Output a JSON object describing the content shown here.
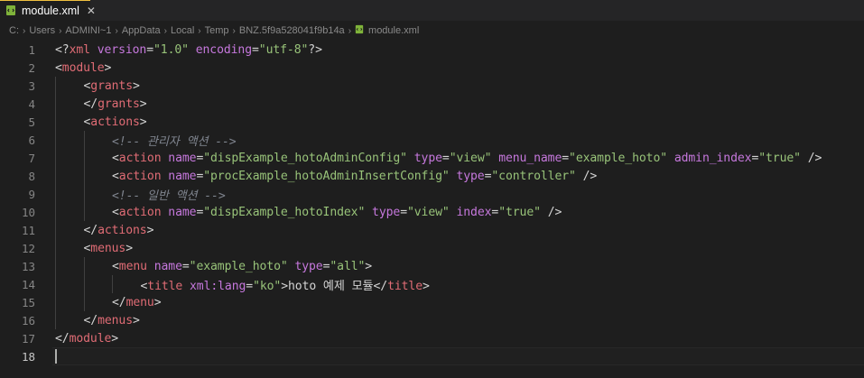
{
  "tab": {
    "name": "module.xml",
    "close": "✕"
  },
  "breadcrumb": {
    "parts": [
      "C:",
      "Users",
      "ADMINI~1",
      "AppData",
      "Local",
      "Temp",
      "BNZ.5f9a528041f9b14a"
    ],
    "file": "module.xml",
    "separator": "›"
  },
  "colors": {
    "tag": "#e06c75",
    "attribute": "#c678dd",
    "string": "#98c379",
    "comment": "#7f848e",
    "bracket": "#56b6c2",
    "file_icon": "#7fb33a"
  },
  "editor": {
    "current_line": 18,
    "lines": [
      {
        "n": "1",
        "indent": 0,
        "tokens": [
          [
            "punct",
            "<?"
          ],
          [
            "tag",
            "xml"
          ],
          [
            "text",
            " "
          ],
          [
            "attr",
            "version"
          ],
          [
            "eq",
            "="
          ],
          [
            "str",
            "\"1.0\""
          ],
          [
            "text",
            " "
          ],
          [
            "attr",
            "encoding"
          ],
          [
            "eq",
            "="
          ],
          [
            "str",
            "\"utf-8\""
          ],
          [
            "punct",
            "?>"
          ]
        ]
      },
      {
        "n": "2",
        "indent": 0,
        "tokens": [
          [
            "punct",
            "<"
          ],
          [
            "tag",
            "module"
          ],
          [
            "punct",
            ">"
          ]
        ]
      },
      {
        "n": "3",
        "indent": 1,
        "tokens": [
          [
            "punct",
            "<"
          ],
          [
            "tag",
            "grants"
          ],
          [
            "punct",
            ">"
          ]
        ]
      },
      {
        "n": "4",
        "indent": 1,
        "tokens": [
          [
            "punct",
            "</"
          ],
          [
            "tag",
            "grants"
          ],
          [
            "punct",
            ">"
          ]
        ]
      },
      {
        "n": "5",
        "indent": 1,
        "tokens": [
          [
            "punct",
            "<"
          ],
          [
            "tag",
            "actions"
          ],
          [
            "punct",
            ">"
          ]
        ]
      },
      {
        "n": "6",
        "indent": 2,
        "tokens": [
          [
            "comment",
            "<!-- 관리자 액션 -->"
          ]
        ]
      },
      {
        "n": "7",
        "indent": 2,
        "tokens": [
          [
            "punct",
            "<"
          ],
          [
            "tag",
            "action"
          ],
          [
            "text",
            " "
          ],
          [
            "attr",
            "name"
          ],
          [
            "eq",
            "="
          ],
          [
            "str",
            "\"dispExample_hotoAdminConfig\""
          ],
          [
            "text",
            " "
          ],
          [
            "attr",
            "type"
          ],
          [
            "eq",
            "="
          ],
          [
            "str",
            "\"view\""
          ],
          [
            "text",
            " "
          ],
          [
            "attr",
            "menu_name"
          ],
          [
            "eq",
            "="
          ],
          [
            "str",
            "\"example_hoto\""
          ],
          [
            "text",
            " "
          ],
          [
            "attr",
            "admin_index"
          ],
          [
            "eq",
            "="
          ],
          [
            "str",
            "\"true\""
          ],
          [
            "text",
            " "
          ],
          [
            "punct",
            "/>"
          ]
        ]
      },
      {
        "n": "8",
        "indent": 2,
        "tokens": [
          [
            "punct",
            "<"
          ],
          [
            "tag",
            "action"
          ],
          [
            "text",
            " "
          ],
          [
            "attr",
            "name"
          ],
          [
            "eq",
            "="
          ],
          [
            "str",
            "\"procExample_hotoAdminInsertConfig\""
          ],
          [
            "text",
            " "
          ],
          [
            "attr",
            "type"
          ],
          [
            "eq",
            "="
          ],
          [
            "str",
            "\"controller\""
          ],
          [
            "text",
            " "
          ],
          [
            "punct",
            "/>"
          ]
        ]
      },
      {
        "n": "9",
        "indent": 2,
        "tokens": [
          [
            "comment",
            "<!-- 일반 액션 -->"
          ]
        ]
      },
      {
        "n": "10",
        "indent": 2,
        "tokens": [
          [
            "punct",
            "<"
          ],
          [
            "tag",
            "action"
          ],
          [
            "text",
            " "
          ],
          [
            "attr",
            "name"
          ],
          [
            "eq",
            "="
          ],
          [
            "str",
            "\"dispExample_hotoIndex\""
          ],
          [
            "text",
            " "
          ],
          [
            "attr",
            "type"
          ],
          [
            "eq",
            "="
          ],
          [
            "str",
            "\"view\""
          ],
          [
            "text",
            " "
          ],
          [
            "attr",
            "index"
          ],
          [
            "eq",
            "="
          ],
          [
            "str",
            "\"true\""
          ],
          [
            "text",
            " "
          ],
          [
            "punct",
            "/>"
          ]
        ]
      },
      {
        "n": "11",
        "indent": 1,
        "tokens": [
          [
            "punct",
            "</"
          ],
          [
            "tag",
            "actions"
          ],
          [
            "punct",
            ">"
          ]
        ]
      },
      {
        "n": "12",
        "indent": 1,
        "tokens": [
          [
            "punct",
            "<"
          ],
          [
            "tag",
            "menus"
          ],
          [
            "punct",
            ">"
          ]
        ]
      },
      {
        "n": "13",
        "indent": 2,
        "tokens": [
          [
            "punct",
            "<"
          ],
          [
            "tag",
            "menu"
          ],
          [
            "text",
            " "
          ],
          [
            "attr",
            "name"
          ],
          [
            "eq",
            "="
          ],
          [
            "str",
            "\"example_hoto\""
          ],
          [
            "text",
            " "
          ],
          [
            "attr",
            "type"
          ],
          [
            "eq",
            "="
          ],
          [
            "str",
            "\"all\""
          ],
          [
            "punct",
            ">"
          ]
        ]
      },
      {
        "n": "14",
        "indent": 3,
        "tokens": [
          [
            "punct",
            "<"
          ],
          [
            "tag",
            "title"
          ],
          [
            "text",
            " "
          ],
          [
            "attr",
            "xml:lang"
          ],
          [
            "eq",
            "="
          ],
          [
            "str",
            "\"ko\""
          ],
          [
            "punct",
            ">"
          ],
          [
            "text",
            "hoto 예제 모듈"
          ],
          [
            "punct",
            "</"
          ],
          [
            "tag",
            "title"
          ],
          [
            "punct",
            ">"
          ]
        ]
      },
      {
        "n": "15",
        "indent": 2,
        "tokens": [
          [
            "punct",
            "</"
          ],
          [
            "tag",
            "menu"
          ],
          [
            "punct",
            ">"
          ]
        ]
      },
      {
        "n": "16",
        "indent": 1,
        "tokens": [
          [
            "punct",
            "</"
          ],
          [
            "tag",
            "menus"
          ],
          [
            "punct",
            ">"
          ]
        ]
      },
      {
        "n": "17",
        "indent": 0,
        "tokens": [
          [
            "punct",
            "</"
          ],
          [
            "tag",
            "module"
          ],
          [
            "punct",
            ">"
          ]
        ]
      },
      {
        "n": "18",
        "indent": 0,
        "tokens": []
      }
    ]
  }
}
